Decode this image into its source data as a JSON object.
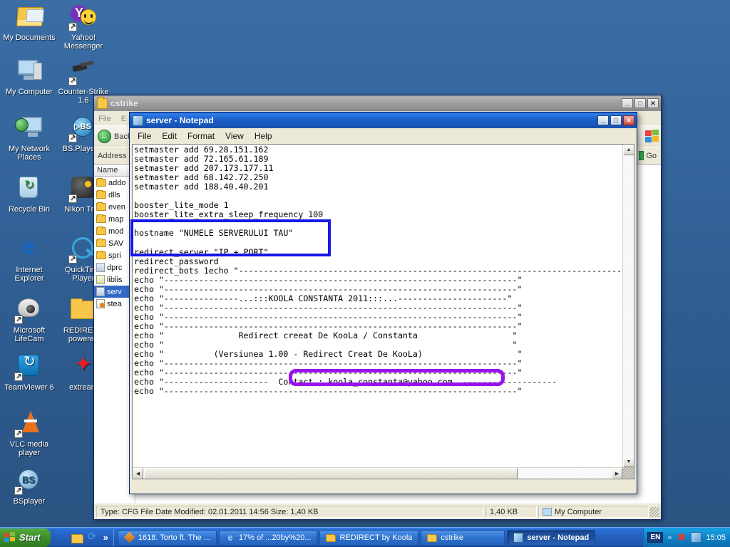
{
  "desktop": {
    "icons": [
      {
        "label": "My Documents",
        "icon": "my-documents-icon"
      },
      {
        "label": "Yahoo! Messenger",
        "icon": "yahoo-messenger-icon"
      },
      {
        "label": "My Computer",
        "icon": "my-computer-icon"
      },
      {
        "label": "Counter-Strike 1.6",
        "icon": "counter-strike-icon"
      },
      {
        "label": "My Network Places",
        "icon": "my-network-places-icon"
      },
      {
        "label": "BS.Player F",
        "icon": "bsplayer-free-icon"
      },
      {
        "label": "Recycle Bin",
        "icon": "recycle-bin-icon"
      },
      {
        "label": "Nikon Tran",
        "icon": "nikon-transfer-icon"
      },
      {
        "label": "Internet Explorer",
        "icon": "internet-explorer-icon"
      },
      {
        "label": "QuickTime Player",
        "icon": "quicktime-player-icon"
      },
      {
        "label": "Microsoft LifeCam",
        "icon": "microsoft-lifecam-icon"
      },
      {
        "label": "REDIRECT powered",
        "icon": "folder-icon"
      },
      {
        "label": "TeamViewer 6",
        "icon": "teamviewer-icon"
      },
      {
        "label": "extream",
        "icon": "extream-icon"
      },
      {
        "label": "VLC media player",
        "icon": "vlc-media-player-icon"
      },
      {
        "label": "BSplayer",
        "icon": "bsplayer-icon"
      }
    ]
  },
  "explorer": {
    "title": "cstrike",
    "title_icon": "folder-icon",
    "buttons": {
      "minimize": "_",
      "maximize": "□",
      "close": "✕"
    },
    "menu": [
      "File",
      "E"
    ],
    "toolbar": {
      "back_label": "Back",
      "back_icon": "back-arrow-icon"
    },
    "address": {
      "label": "Address",
      "value": ""
    },
    "go_label": "Go",
    "column_header": "Name",
    "items": [
      {
        "name": "addo",
        "type": "folder"
      },
      {
        "name": "dlls",
        "type": "folder"
      },
      {
        "name": "even",
        "type": "folder"
      },
      {
        "name": "map",
        "type": "folder"
      },
      {
        "name": "mod",
        "type": "folder"
      },
      {
        "name": "SAV",
        "type": "folder"
      },
      {
        "name": "spri",
        "type": "folder"
      },
      {
        "name": "dprc",
        "type": "cfg"
      },
      {
        "name": "liblis",
        "type": "dll"
      },
      {
        "name": "serv",
        "type": "cfg",
        "selected": true
      },
      {
        "name": "stea",
        "type": "steam"
      }
    ],
    "status": {
      "details": "Type: CFG File Date Modified: 02.01.2011 14:56 Size: 1,40 KB",
      "size": "1,40 KB",
      "location": "My Computer"
    }
  },
  "notepad": {
    "title": "server - Notepad",
    "title_icon": "notepad-icon",
    "buttons": {
      "minimize": "_",
      "maximize": "□",
      "close": "✕"
    },
    "menu": [
      "File",
      "Edit",
      "Format",
      "View",
      "Help"
    ],
    "content": "setmaster add 69.28.151.162\nsetmaster add 72.165.61.189\nsetmaster add 207.173.177.11\nsetmaster add 68.142.72.250\nsetmaster add 188.40.40.201\n\nbooster_lite_mode 1\nbooster_lite_extra_sleep_frequency 100\n\nhostname \"NUMELE SERVERULUI TAU\"\n\nredirect_server \"IP + PORT\"\nredirect_password\nredirect_bots 1echo \"-----------------------------------------------------------------------------\necho \"-----------------------------------------------------------------------\"\necho \"-----------------------------------------------------------------------\"\necho \"---------------...:::KOOLA CONSTANTA 2011:::...----------------------\"\necho \"-----------------------------------------------------------------------\"\necho \"-----------------------------------------------------------------------\"\necho \"-----------------------------------------------------------------------\"\necho \"               Redirect creeat De KooLa / Constanta                   \"\necho \"                                                                      \"\necho \"          (Versiunea 1.00 - Redirect Creat De KooLa)                   \"\necho \"-----------------------------------------------------------------------\"\necho \"-----------------------------------------------------------------------\"\necho \"---------------------  Contact : koola_constanta@yahoo.com  -------------------\necho \"-----------------------------------------------------------------------\"",
    "annotations": [
      {
        "name": "hostname-redirect-highlight",
        "color": "#1717e8",
        "shape": "rectangle",
        "targets": [
          "hostname \"NUMELE SERVERULUI TAU\"",
          "redirect_server \"IP + PORT\""
        ]
      },
      {
        "name": "contact-email-highlight",
        "color": "#9911ee",
        "shape": "rounded-rectangle",
        "targets": [
          "Contact : koola_constanta@yahoo.com"
        ]
      }
    ]
  },
  "taskbar": {
    "start_label": "Start",
    "quick_launch": [
      {
        "icon": "internet-explorer-icon"
      },
      {
        "icon": "show-desktop-icon"
      },
      {
        "icon": "refresh-icon"
      },
      {
        "icon": "chevron-right-icon",
        "label": "»"
      }
    ],
    "windows": [
      {
        "label": "1618. Torto ft. The ...",
        "icon": "media-icon",
        "active": false
      },
      {
        "label": "17% of ...20by%20...",
        "icon": "internet-explorer-icon",
        "active": false
      },
      {
        "label": "REDIRECT by Koola",
        "icon": "folder-icon",
        "active": false
      },
      {
        "label": "cstrike",
        "icon": "folder-icon",
        "active": false
      },
      {
        "label": "server - Notepad",
        "icon": "notepad-icon",
        "active": true
      }
    ],
    "tray": {
      "language": "EN",
      "chevron": "«",
      "icons": [
        "antivirus-icon",
        "network-icon"
      ],
      "clock": "15:05"
    }
  }
}
